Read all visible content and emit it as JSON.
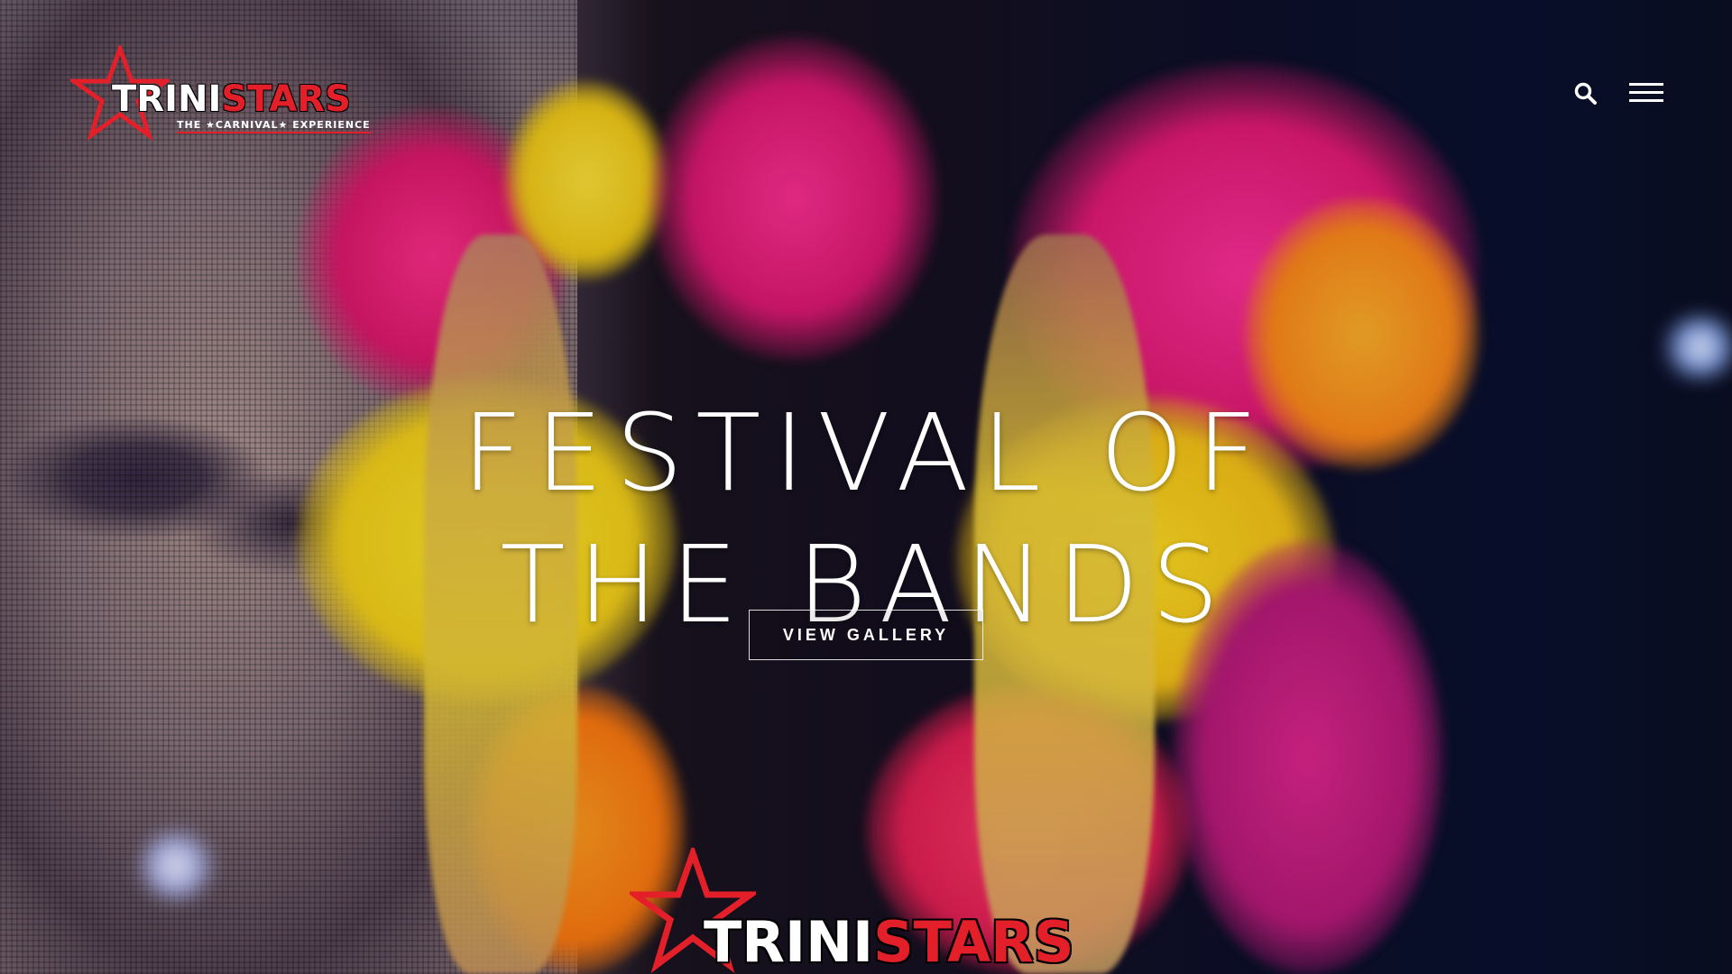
{
  "header": {
    "logo": {
      "word_part1": "TRINI",
      "word_part2": "STARS",
      "tagline": "THE ★CARNIVAL★ EXPERIENCE"
    },
    "search_icon": "search-icon",
    "menu_icon": "hamburger-menu-icon"
  },
  "hero": {
    "headline": "FESTIVAL OF THE BANDS",
    "cta_label": "VIEW GALLERY"
  },
  "footer_logo": {
    "word_part1": "TRINI",
    "word_part2": "STARS"
  },
  "colors": {
    "brand_red": "#e3202a",
    "text": "#ffffff"
  }
}
